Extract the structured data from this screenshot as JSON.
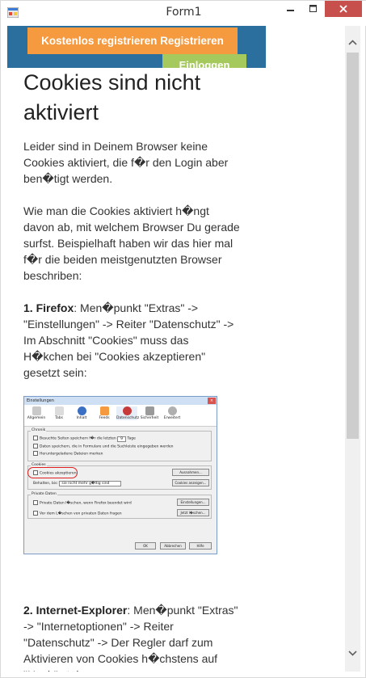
{
  "window": {
    "title": "Form1",
    "minimize_icon": "minimize-icon",
    "maximize_icon": "maximize-icon",
    "close_icon": "close-icon",
    "close_color": "#c7504c"
  },
  "header": {
    "register_label": "Kostenlos registrieren Registrieren",
    "login_label": "Einloggen",
    "register_color": "#f59a3e",
    "login_color": "#a6c95d",
    "banner_color": "#2a6f9d"
  },
  "article": {
    "heading": "Cookies sind nicht aktiviert",
    "p1": "Leider sind in Deinem Browser keine Cookies aktiviert, die f�r den Login aber ben�tigt werden.",
    "p2": "Wie man die Cookies aktiviert h�ngt davon ab, mit welchem Browser Du gerade surfst. Beispielhaft haben wir das hier mal f�r die beiden meistgenutzten Browser beschriben:",
    "p3_bold": "1. Firefox",
    "p3": ": Men�punkt \"Extras\" -> \"Einstellungen\" -> Reiter \"Datenschutz\" -> Im Abschnitt \"Cookies\" muss das H�kchen bei \"Cookies akzeptieren\" gesetzt sein:",
    "p4_bold": "2. Internet-Explorer",
    "p4": ": Men�punkt \"Extras\" -> \"Internetoptionen\" -> Reiter \"Datenschutz\" -> Der Regler darf zum Aktivieren von Cookies h�chstens auf \"Hoch\" stehen."
  },
  "screenshot": {
    "title": "Einstellungen",
    "tabs": [
      "Allgemein",
      "Tabs",
      "Inhalt",
      "Feeds",
      "Datenschutz",
      "Sicherheit",
      "Erweitert"
    ],
    "chronik_title": "Chronik",
    "chronik_1": "Besuchte Seiten speichern f�r die letzten",
    "chronik_1_val": "9",
    "chronik_1_unit": "Tage",
    "chronik_2": "Daten speichern, die in Formulare und die Suchleiste eingegeben werden",
    "chronik_3": "Heruntergeladene Dateien merken",
    "cookies_title": "Cookies",
    "cookies_accept": "Cookies akzeptieren",
    "cookies_ausnahmen": "Ausnahmen...",
    "cookies_behalten": "Behalten, bis:",
    "cookies_behalten_val": "sie nicht mehr g�ltig sind",
    "cookies_anzeigen": "Cookies anzeigen...",
    "private_title": "Private Daten",
    "private_1": "Private Daten l�schen, wenn Firefox beendet wird",
    "private_einstellungen": "Einstellungen...",
    "private_2": "Vor dem L�schen von privaten Daten fragen",
    "private_jetzt": "Jetzt l�schen...",
    "ok": "OK",
    "abbrechen": "Abbrechen",
    "hilfe": "Hilfe"
  },
  "scrollbar": {
    "up_icon": "scroll-up-arrow-icon",
    "down_icon": "scroll-down-arrow-icon"
  }
}
